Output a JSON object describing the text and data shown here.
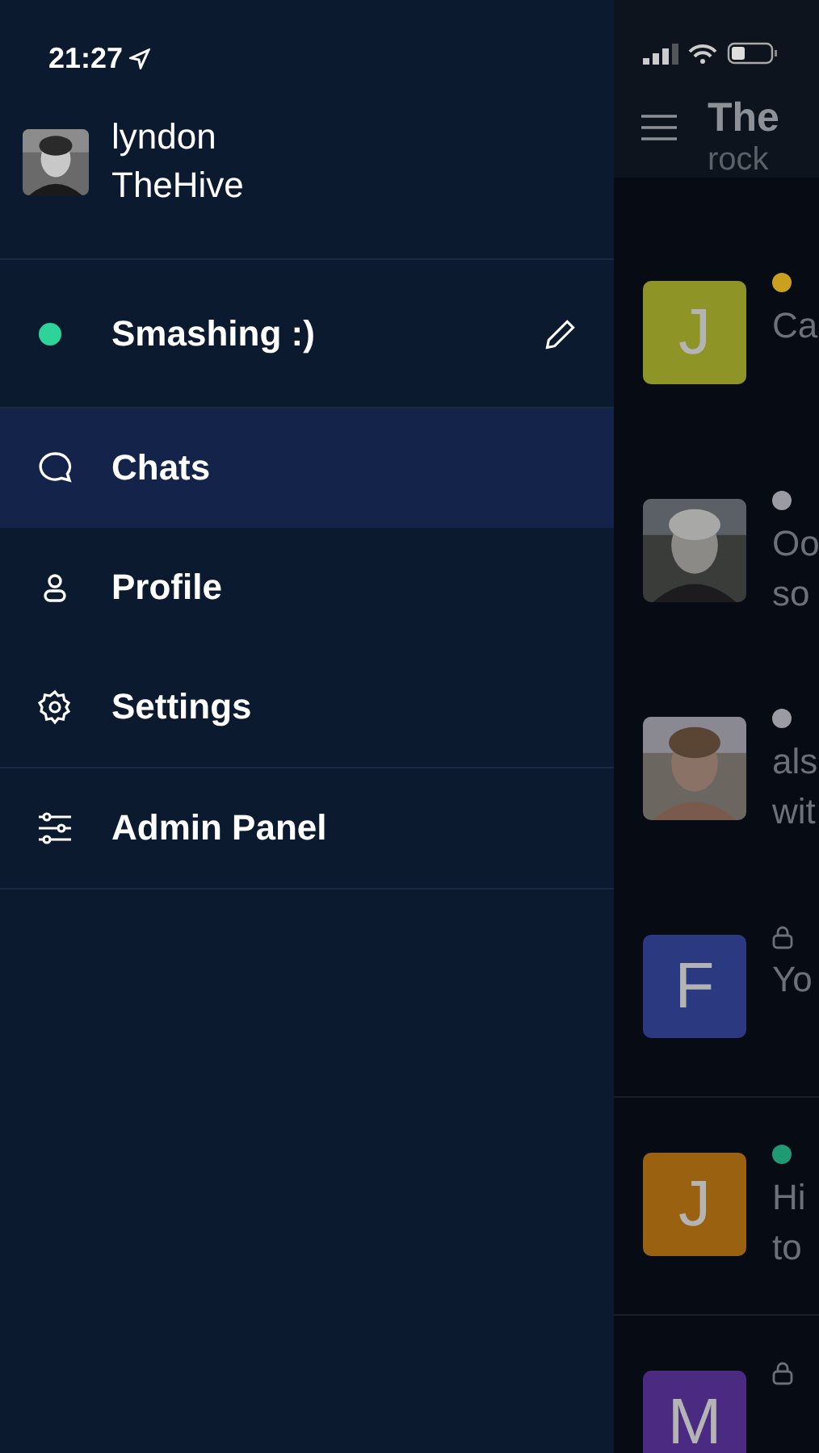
{
  "status_bar": {
    "time": "21:27"
  },
  "drawer": {
    "user": {
      "name": "lyndon",
      "server": "TheHive"
    },
    "status": {
      "text": "Smashing :)",
      "color": "#2ed39a"
    },
    "menu": [
      {
        "label": "Chats",
        "kind": "chat",
        "selected": true,
        "divider_after": false
      },
      {
        "label": "Profile",
        "kind": "person",
        "selected": false,
        "divider_after": false
      },
      {
        "label": "Settings",
        "kind": "gear",
        "selected": false,
        "divider_after": true
      },
      {
        "label": "Admin Panel",
        "kind": "sliders",
        "selected": false,
        "divider_after": true
      }
    ]
  },
  "chat_list": {
    "title": "The",
    "subtitle": "rock",
    "rows": [
      {
        "avatar": {
          "kind": "letter",
          "letter": "J",
          "color": "#8f9426"
        },
        "marker": {
          "kind": "dot",
          "color": "#c9a020"
        },
        "preview": [
          "Ca"
        ],
        "divider": false
      },
      {
        "marker": {
          "kind": "dot",
          "color": "#9a9ca2"
        },
        "preview": [
          "Oo",
          "so"
        ],
        "divider": false
      },
      {
        "marker": {
          "kind": "dot",
          "color": "#9a9ca2"
        },
        "preview": [
          "als",
          "wit"
        ],
        "divider": false
      },
      {
        "avatar": {
          "kind": "letter",
          "letter": "F",
          "color": "#2b3a80"
        },
        "marker": {
          "kind": "lock"
        },
        "preview": [
          "Yo"
        ],
        "divider": true
      },
      {
        "avatar": {
          "kind": "letter",
          "letter": "J",
          "color": "#9a6210"
        },
        "marker": {
          "kind": "dot",
          "color": "#1f9a72"
        },
        "preview": [
          "Hi",
          "to"
        ],
        "divider": true
      },
      {
        "avatar": {
          "kind": "letter",
          "letter": "M",
          "color": "#4b2a82"
        },
        "marker": {
          "kind": "lock"
        },
        "preview": []
      }
    ]
  }
}
